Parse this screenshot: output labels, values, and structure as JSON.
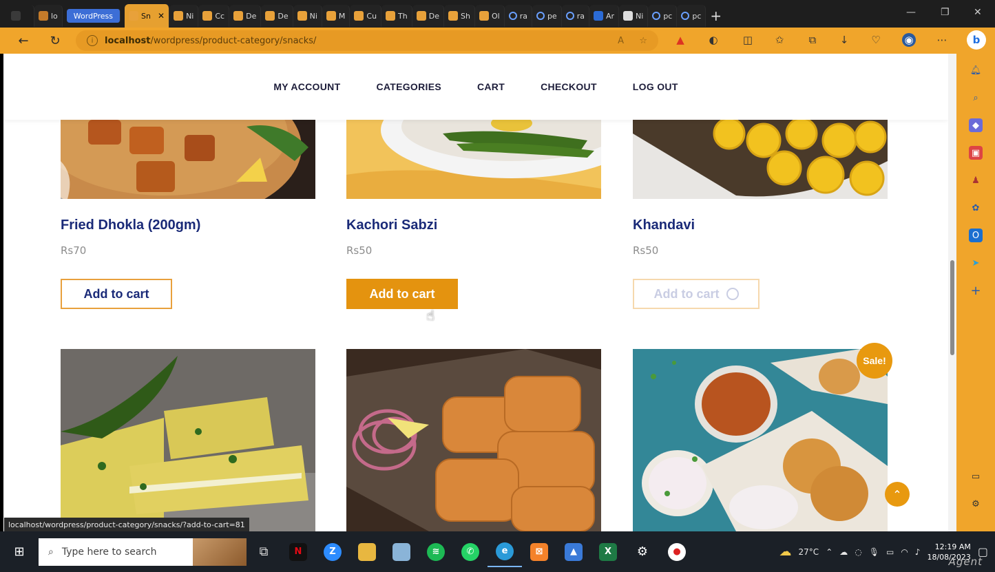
{
  "browser": {
    "tabs": [
      {
        "label": "lo",
        "icon": "site-icon"
      },
      {
        "label": "WordPress",
        "icon": "wordpress-group"
      },
      {
        "label": "Sn",
        "icon": "xampp-icon",
        "active": true
      },
      {
        "label": "Ni",
        "icon": "xampp-icon"
      },
      {
        "label": "Cc",
        "icon": "xampp-icon"
      },
      {
        "label": "De",
        "icon": "xampp-icon"
      },
      {
        "label": "De",
        "icon": "xampp-icon"
      },
      {
        "label": "Ni",
        "icon": "xampp-icon"
      },
      {
        "label": "M",
        "icon": "xampp-icon"
      },
      {
        "label": "Cu",
        "icon": "xampp-icon"
      },
      {
        "label": "Th",
        "icon": "xampp-icon"
      },
      {
        "label": "De",
        "icon": "xampp-icon"
      },
      {
        "label": "Sh",
        "icon": "xampp-icon"
      },
      {
        "label": "Ol",
        "icon": "xampp-icon"
      },
      {
        "label": "ra",
        "icon": "search-icon"
      },
      {
        "label": "pe",
        "icon": "search-icon"
      },
      {
        "label": "ra",
        "icon": "search-icon"
      },
      {
        "label": "Ar",
        "icon": "feather-icon"
      },
      {
        "label": "Ni",
        "icon": "doc-icon"
      },
      {
        "label": "pc",
        "icon": "search-icon"
      },
      {
        "label": "pc",
        "icon": "search-icon"
      }
    ],
    "tab_close": "✕",
    "new_tab": "+",
    "url_host": "localhost",
    "url_path": "/wordpress/product-category/snacks/",
    "window_controls": [
      "—",
      "❐",
      "✕"
    ]
  },
  "site": {
    "nav": [
      "MY ACCOUNT",
      "CATEGORIES",
      "CART",
      "CHECKOUT",
      "LOG OUT"
    ],
    "products_row1": [
      {
        "name": "Fried Dhokla (200gm)",
        "price": "Rs70",
        "button": "Add to cart",
        "state": "normal"
      },
      {
        "name": "Kachori Sabzi",
        "price": "Rs50",
        "button": "Add to cart",
        "state": "hover"
      },
      {
        "name": "Khandavi",
        "price": "Rs50",
        "button": "Add to cart",
        "state": "loading"
      }
    ],
    "sale_badge": "Sale!",
    "scroll_top": "⌃"
  },
  "status_url": "localhost/wordpress/product-category/snacks/?add-to-cart=81",
  "taskbar": {
    "search_placeholder": "Type here to search",
    "weather": "27°C",
    "time": "12:19 AM",
    "date": "18/08/2023"
  },
  "watermark": "Agent"
}
